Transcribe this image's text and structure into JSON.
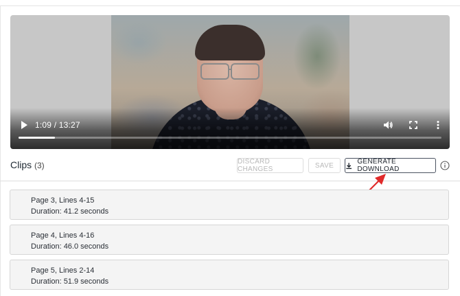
{
  "player": {
    "current_time": "1:09",
    "duration": "13:27",
    "time_display": "1:09 / 13:27",
    "progress_fraction": 0.086,
    "icons": [
      "play-icon",
      "volume-icon",
      "fullscreen-icon",
      "more-vert-icon"
    ]
  },
  "clips_header": {
    "title": "Clips",
    "count": "(3)"
  },
  "toolbar": {
    "discard_label": "DISCARD CHANGES",
    "save_label": "SAVE",
    "generate_label": "GENERATE DOWNLOAD",
    "generate_icon": "download-icon",
    "info_icon": "info-icon"
  },
  "clips": [
    {
      "title": "Page 3, Lines 4-15",
      "duration": "Duration: 41.2 seconds"
    },
    {
      "title": "Page 4, Lines 4-16",
      "duration": "Duration: 46.0 seconds"
    },
    {
      "title": "Page 5, Lines 2-14",
      "duration": "Duration: 51.9 seconds"
    }
  ],
  "colors": {
    "arrow": "#e02a2a",
    "primary_button_border": "#4a5260",
    "disabled_text": "#b8b8b8",
    "clip_background": "#f4f4f4"
  }
}
